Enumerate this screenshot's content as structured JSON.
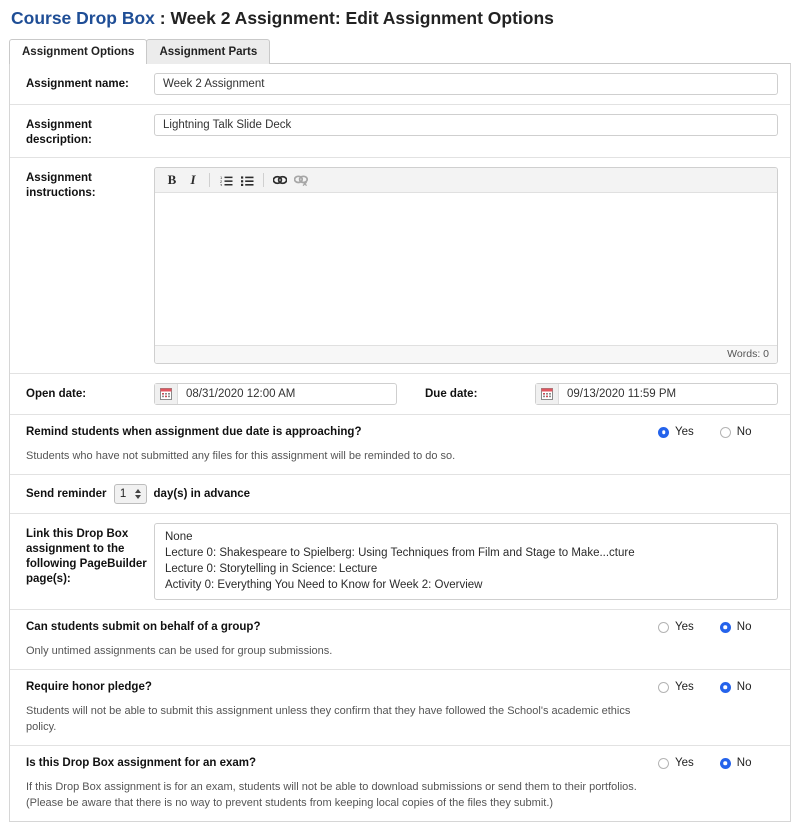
{
  "header": {
    "brand": "Course Drop Box",
    "separator": " : ",
    "subtitle": "Week 2 Assignment: Edit Assignment Options",
    "brand_color": "#1f4e96"
  },
  "tabs": [
    {
      "label": "Assignment Options",
      "active": true
    },
    {
      "label": "Assignment Parts",
      "active": false
    }
  ],
  "fields": {
    "assignment_name": {
      "label": "Assignment name:",
      "value": "Week 2 Assignment"
    },
    "assignment_description": {
      "label": "Assignment description:",
      "value": "Lightning Talk Slide Deck"
    },
    "assignment_instructions": {
      "label": "Assignment instructions:",
      "value": "",
      "word_count": "Words: 0",
      "toolbar": [
        {
          "name": "bold-icon",
          "glyph": "B",
          "disabled": false
        },
        {
          "name": "italic-icon",
          "glyph": "I",
          "disabled": false
        },
        {
          "name": "numbered-list-icon",
          "glyph": "",
          "disabled": false
        },
        {
          "name": "bulleted-list-icon",
          "glyph": "",
          "disabled": false
        },
        {
          "name": "link-icon",
          "glyph": "",
          "disabled": false
        },
        {
          "name": "unlink-icon",
          "glyph": "",
          "disabled": true
        }
      ]
    },
    "open_date": {
      "label": "Open date:",
      "value": "08/31/2020 12:00 AM"
    },
    "due_date": {
      "label": "Due date:",
      "value": "09/13/2020 11:59 PM"
    },
    "send_reminder": {
      "prefix_label": "Send reminder",
      "value": "1",
      "suffix_label": "day(s) in advance"
    },
    "pagebuilder_link": {
      "label": "Link this Drop Box assignment to the following PageBuilder page(s):",
      "options": [
        "None",
        "Lecture 0: Shakespeare to Spielberg: Using Techniques from Film and Stage to Make...cture",
        "Lecture 0: Storytelling in Science: Lecture",
        "Activity 0: Everything You Need to Know for Week 2: Overview"
      ]
    }
  },
  "questions": [
    {
      "title": "Remind students when assignment due date is approaching?",
      "help": "Students who have not submitted any files for this assignment will be reminded to do so.",
      "yes_label": "Yes",
      "no_label": "No",
      "selected": "yes"
    },
    {
      "title": "Can students submit on behalf of a group?",
      "help": "Only untimed assignments can be used for group submissions.",
      "yes_label": "Yes",
      "no_label": "No",
      "selected": "no"
    },
    {
      "title": "Require honor pledge?",
      "help": "Students will not be able to submit this assignment unless they confirm that they have followed the School's academic ethics policy.",
      "yes_label": "Yes",
      "no_label": "No",
      "selected": "no"
    },
    {
      "title": "Is this Drop Box assignment for an exam?",
      "help": "If this Drop Box assignment is for an exam, students will not be able to download submissions or send them to their portfolios. (Please be aware that there is no way to prevent students from keeping local copies of the files they submit.)",
      "yes_label": "Yes",
      "no_label": "No",
      "selected": "no"
    }
  ],
  "colors": {
    "accent_blue": "#2563eb",
    "title_blue": "#1f4e96"
  }
}
